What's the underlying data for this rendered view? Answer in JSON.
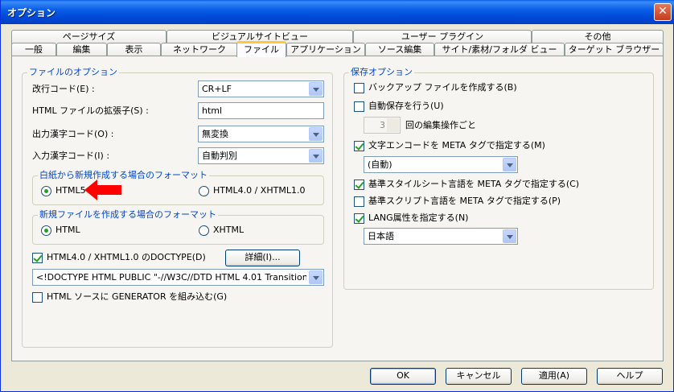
{
  "window": {
    "title": "オプション",
    "close_label": "✕"
  },
  "tabs_back": [
    {
      "label": "ページサイズ"
    },
    {
      "label": "ビジュアルサイトビュー"
    },
    {
      "label": "ユーザー プラグイン"
    },
    {
      "label": "その他"
    }
  ],
  "tabs_front": [
    {
      "label": "一般"
    },
    {
      "label": "編集"
    },
    {
      "label": "表示"
    },
    {
      "label": "ネットワーク"
    },
    {
      "label": "ファイル"
    },
    {
      "label": "アプリケーション"
    },
    {
      "label": "ソース編集"
    },
    {
      "label": "サイト/素材/フォルダ ビュー"
    },
    {
      "label": "ターゲット ブラウザー"
    }
  ],
  "file_options": {
    "group_title": "ファイルのオプション",
    "newline_label": "改行コード(E) :",
    "newline_value": "CR+LF",
    "ext_label": "HTML ファイルの拡張子(S) :",
    "ext_value": "html",
    "out_encoding_label": "出力漢字コード(O) :",
    "out_encoding_value": "無変換",
    "in_encoding_label": "入力漢字コード(I) :",
    "in_encoding_value": "自動判別",
    "blank_group_title": "白紙から新規作成する場合のフォーマット",
    "blank_opt1": "HTML5",
    "blank_opt2": "HTML4.0 / XHTML1.0",
    "new_group_title": "新規ファイルを作成する場合のフォーマット",
    "new_opt1": "HTML",
    "new_opt2": "XHTML",
    "doctype_label": "HTML4.0 / XHTML1.0 のDOCTYPE(D)",
    "details_button": "詳細(I)...",
    "doctype_value": "<!DOCTYPE HTML PUBLIC \"-//W3C//DTD HTML 4.01 Transitional//EN\">",
    "generator_label": "HTML ソースに GENERATOR を組み込む(G)"
  },
  "save_options": {
    "group_title": "保存オプション",
    "backup_label": "バックアップ ファイルを作成する(B)",
    "autosave_label": "自動保存を行う(U)",
    "autosave_count": "3",
    "autosave_suffix": "回の編集操作ごと",
    "meta_charset_label": "文字エンコードを META タグで指定する(M)",
    "meta_charset_value": "(自動)",
    "style_lang_label": "基準スタイルシート言語を META タグで指定する(C)",
    "script_lang_label": "基準スクリプト言語を META タグで指定する(P)",
    "lang_attr_label": "LANG属性を指定する(N)",
    "lang_value": "日本語"
  },
  "buttons": {
    "ok": "OK",
    "cancel": "キャンセル",
    "apply": "適用(A)",
    "help": "ヘルプ"
  },
  "colors": {
    "accent": "#0046d5",
    "arrow": "#ff0000"
  }
}
